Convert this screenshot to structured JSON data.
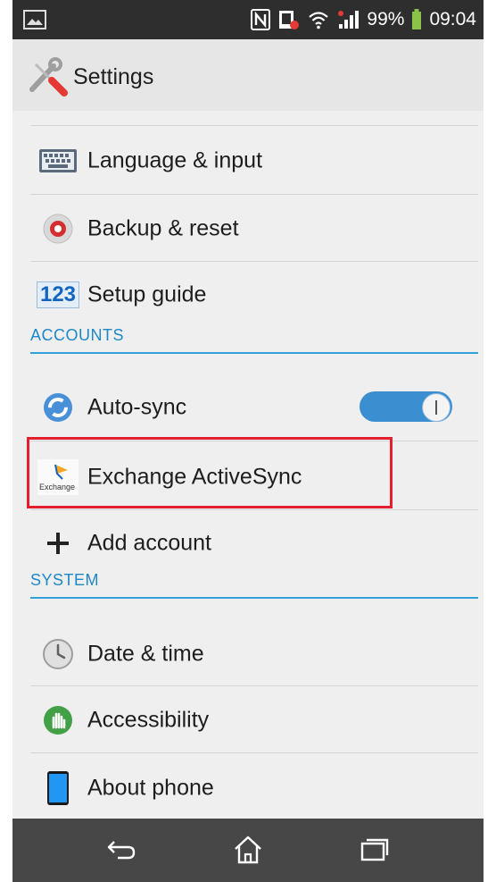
{
  "statusbar": {
    "battery": "99%",
    "time": "09:04",
    "icons": [
      "image-icon",
      "nfc-icon",
      "data-icon",
      "wifi-icon",
      "signal-icon",
      "battery-icon"
    ]
  },
  "actionbar": {
    "title": "Settings",
    "icon": "wrench-screwdriver-icon"
  },
  "items": {
    "language": "Language & input",
    "backup": "Backup & reset",
    "setup": "Setup guide",
    "autosync": "Auto-sync",
    "exchange": "Exchange ActiveSync",
    "add_account": "Add account",
    "date": "Date & time",
    "accessibility": "Accessibility",
    "about": "About phone"
  },
  "sections": {
    "accounts": "ACCOUNTS",
    "system": "SYSTEM"
  },
  "icon_text": {
    "setup_glyph": "123",
    "exchange_logo": "Exchange"
  },
  "autosync_toggle": {
    "state": "on"
  },
  "colors": {
    "accent": "#33a1d9",
    "highlight": "#e3202f",
    "statusbar": "#2e2e2e",
    "navbar": "#474747"
  },
  "navbar": {
    "buttons": [
      "back-icon",
      "home-icon",
      "recent-apps-icon"
    ]
  }
}
